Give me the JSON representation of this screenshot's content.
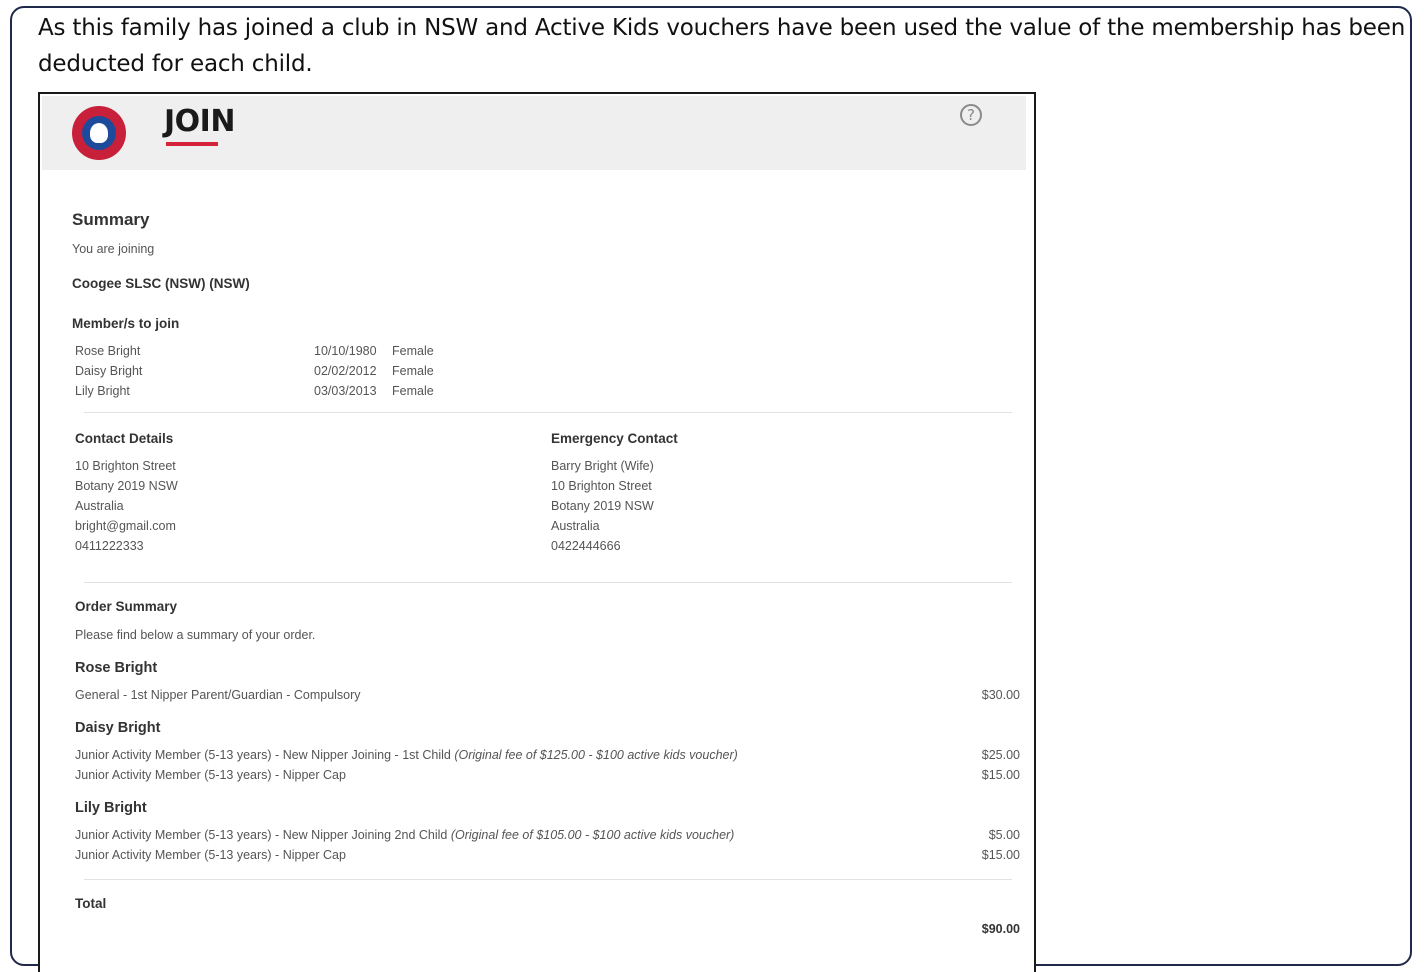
{
  "intro_text": "As this family has joined a club in NSW and Active Kids vouchers have been used the value of the membership has been deducted for each child.",
  "header": {
    "title": "JOIN",
    "help_icon": "question-circle-icon",
    "logo_icon": "surf-life-saving-logo"
  },
  "summary": {
    "heading": "Summary",
    "joining_label": "You are joining",
    "club": "Coogee SLSC (NSW) (NSW)",
    "members_heading": "Member/s to join",
    "members": [
      {
        "name": "Rose Bright",
        "dob": "10/10/1980",
        "gender": "Female"
      },
      {
        "name": "Daisy Bright",
        "dob": "02/02/2012",
        "gender": "Female"
      },
      {
        "name": "Lily Bright",
        "dob": "03/03/2013",
        "gender": "Female"
      }
    ]
  },
  "contact": {
    "heading": "Contact Details",
    "lines": [
      "10 Brighton Street",
      "Botany 2019 NSW",
      "Australia",
      "bright@gmail.com",
      "0411222333"
    ]
  },
  "emergency": {
    "heading": "Emergency Contact",
    "lines": [
      "Barry Bright (Wife)",
      "10 Brighton Street",
      "Botany 2019 NSW",
      "Australia",
      "0422444666"
    ]
  },
  "order": {
    "heading": "Order Summary",
    "subtitle": "Please find below a summary of your order.",
    "groups": [
      {
        "name": "Rose Bright",
        "items": [
          {
            "desc": "General - 1st Nipper Parent/Guardian - Compulsory",
            "note": "",
            "price": "$30.00"
          }
        ]
      },
      {
        "name": "Daisy Bright",
        "items": [
          {
            "desc": "Junior Activity Member (5-13 years) - New Nipper Joining - 1st Child",
            "note": "(Original fee of $125.00 - $100 active kids voucher)",
            "price": "$25.00"
          },
          {
            "desc": "Junior Activity Member (5-13 years) - Nipper Cap",
            "note": "",
            "price": "$15.00"
          }
        ]
      },
      {
        "name": "Lily Bright",
        "items": [
          {
            "desc": "Junior Activity Member (5-13 years) - New Nipper Joining 2nd Child",
            "note": "(Original fee of $105.00 - $100 active kids voucher)",
            "price": "$5.00"
          },
          {
            "desc": "Junior Activity Member (5-13 years) - Nipper Cap",
            "note": "",
            "price": "$15.00"
          }
        ]
      }
    ],
    "total_label": "Total",
    "total_value": "$90.00"
  }
}
